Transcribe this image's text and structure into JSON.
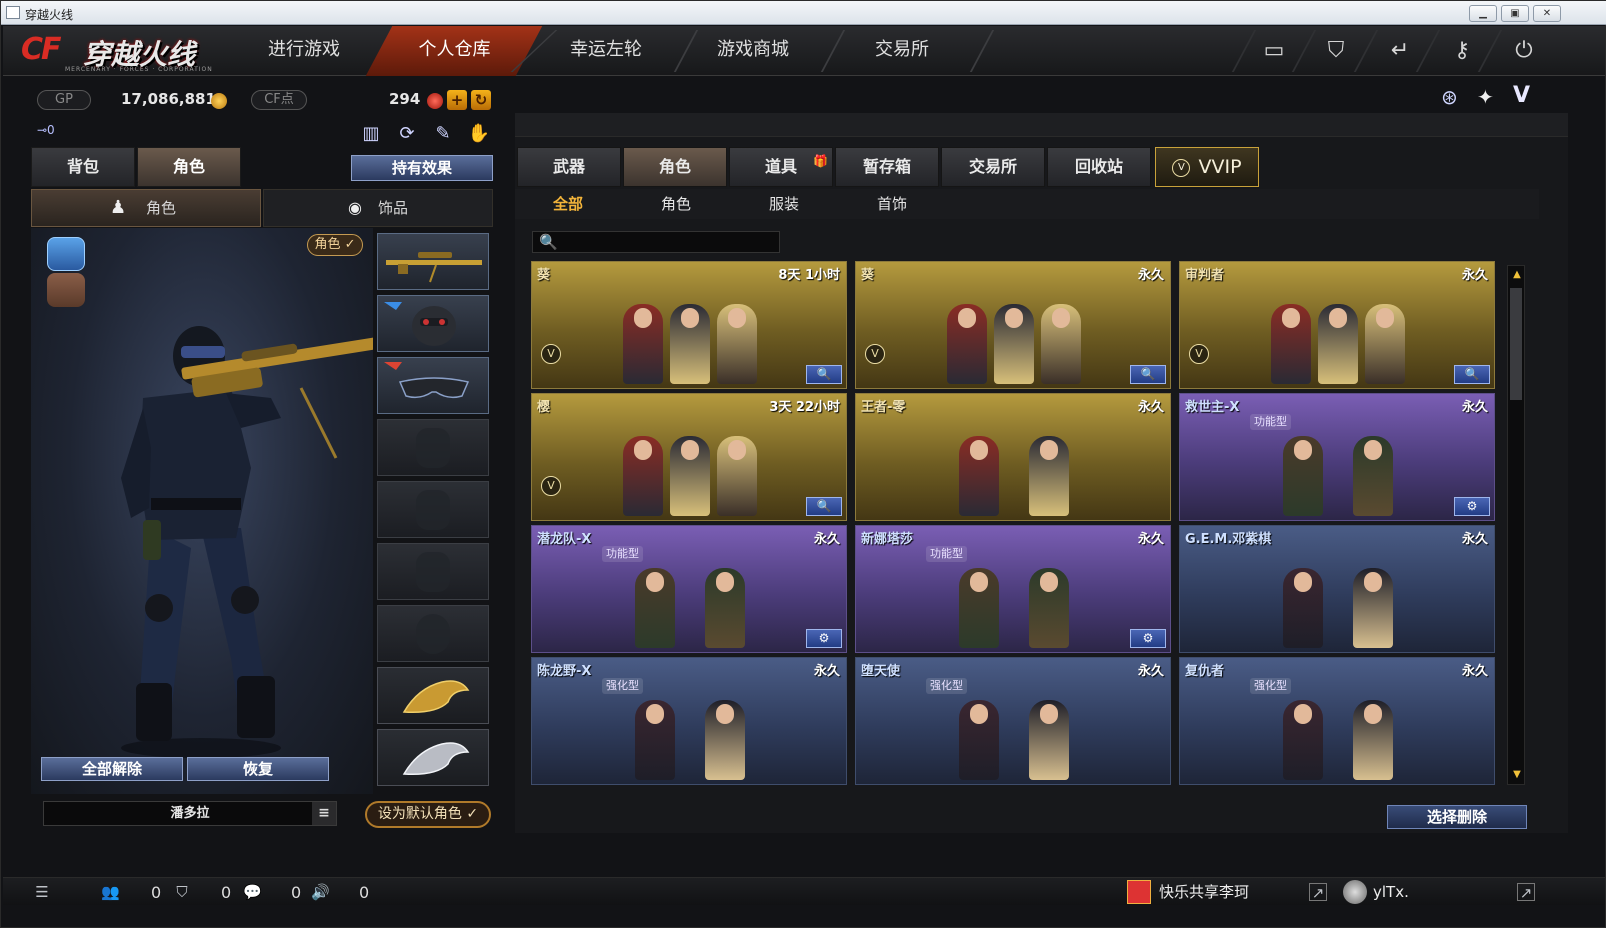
{
  "window": {
    "title": "穿越火线",
    "controls": [
      "minimize",
      "maximize",
      "close"
    ]
  },
  "logo": {
    "mark": "CF",
    "text": "穿越火线",
    "subtitle": "MERCENARY · FORCES · CORPORATION"
  },
  "nav": {
    "tabs": [
      "进行游戏",
      "个人仓库",
      "幸运左轮",
      "游戏商城",
      "交易所"
    ],
    "active": "个人仓库",
    "right_icons": [
      "inventory-box-icon",
      "shield-icon",
      "return-icon",
      "key-icon",
      "power-icon"
    ]
  },
  "currency": {
    "gp_label": "GP",
    "gp_value": "17,086,881",
    "cf_label": "CF点",
    "cf_value": "294"
  },
  "left": {
    "key_icon_text": "⊸0",
    "tabs": [
      "背包",
      "角色"
    ],
    "active_tab": "角色",
    "effects_button": "持有效果",
    "subtabs": [
      "角色",
      "饰品"
    ],
    "active_subtab": "角色",
    "char_badge": "角色 ✓",
    "unequip_all": "全部解除",
    "restore": "恢复",
    "character_name": "潘多拉",
    "set_default": "设为默认角色 ✓"
  },
  "right": {
    "categories": [
      "武器",
      "角色",
      "道具",
      "暂存箱",
      "交易所",
      "回收站",
      "VVIP"
    ],
    "active_category": "角色",
    "filters": [
      "全部",
      "角色",
      "服装",
      "首饰"
    ],
    "active_filter": "全部",
    "search_placeholder": "",
    "delete_button": "选择删除",
    "items": [
      {
        "name": "葵",
        "duration": "8天 1小时",
        "style": "gold",
        "tag": "",
        "vip": true,
        "action": "🔍"
      },
      {
        "name": "葵",
        "duration": "永久",
        "style": "gold",
        "tag": "",
        "vip": true,
        "action": "🔍"
      },
      {
        "name": "审判者",
        "duration": "永久",
        "style": "gold",
        "tag": "",
        "vip": true,
        "action": "🔍"
      },
      {
        "name": "樱",
        "duration": "3天 22小时",
        "style": "gold",
        "tag": "",
        "vip": true,
        "action": "🔍"
      },
      {
        "name": "王者-零",
        "duration": "永久",
        "style": "gold",
        "tag": "",
        "vip": false,
        "action": ""
      },
      {
        "name": "救世主-X",
        "duration": "永久",
        "style": "purple",
        "tag": "功能型",
        "vip": false,
        "action": "⚙"
      },
      {
        "name": "潜龙队-X",
        "duration": "永久",
        "style": "purple",
        "tag": "功能型",
        "vip": false,
        "action": "⚙"
      },
      {
        "name": "新娜塔莎",
        "duration": "永久",
        "style": "purple",
        "tag": "功能型",
        "vip": false,
        "action": "⚙"
      },
      {
        "name": "G.E.M.邓紫棋",
        "duration": "永久",
        "style": "blue",
        "tag": "",
        "vip": false,
        "action": ""
      },
      {
        "name": "陈龙野-X",
        "duration": "永久",
        "style": "blue",
        "tag": "强化型",
        "vip": false,
        "action": ""
      },
      {
        "name": "堕天使",
        "duration": "永久",
        "style": "blue",
        "tag": "强化型",
        "vip": false,
        "action": ""
      },
      {
        "name": "复仇者",
        "duration": "永久",
        "style": "blue",
        "tag": "强化型",
        "vip": false,
        "action": ""
      }
    ]
  },
  "status": {
    "counts": [
      "0",
      "0",
      "0",
      "0"
    ],
    "friend1": "快乐共享李珂",
    "friend2": "ylTx."
  },
  "colors": {
    "accent": "#a33217",
    "gold_text": "#f3b43a",
    "highlight_border": "#c9a23a"
  }
}
